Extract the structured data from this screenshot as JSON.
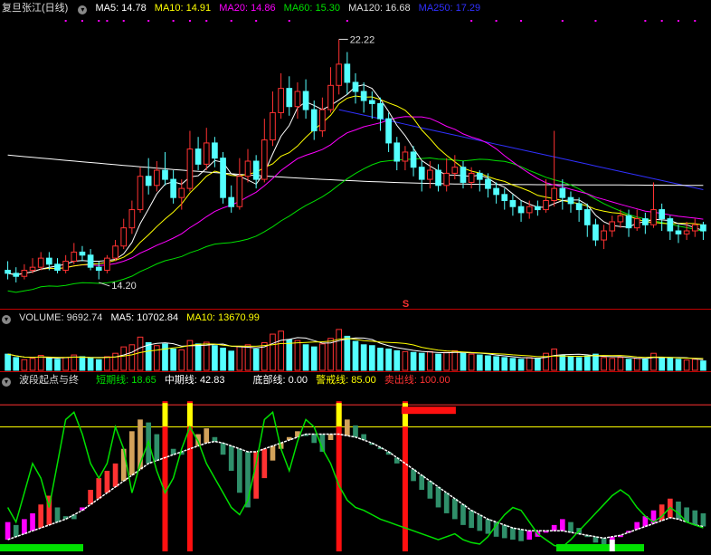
{
  "colors": {
    "bg": "#000000",
    "up": "#ff3232",
    "down": "#54ffff",
    "ma5": "#ffffff",
    "ma10": "#ffff00",
    "ma20": "#ff00ff",
    "ma60": "#00e000",
    "ma120": "#ffffff",
    "ma250": "#3030ff",
    "divider": "#c00000"
  },
  "price_panel": {
    "title": "复旦张江(日线)",
    "toggle_icon": "chevron-down-icon",
    "ma5_label": "MA5: 14.78",
    "ma10_label": "MA10: 14.91",
    "ma20_label": "MA20: 14.86",
    "ma60_label": "MA60: 15.30",
    "ma120_label": "MA120: 16.68",
    "ma250_label": "MA250: 17.29",
    "high_label": "22.22",
    "low_label": "14.20",
    "signal_mark": "S"
  },
  "volume_panel": {
    "volume_label": "VOLUME: 9692.74",
    "ma5_label": "MA5: 10702.84",
    "ma10_label": "MA10: 13670.99"
  },
  "indicator_panel": {
    "title": "波段起点与终",
    "short_label": "短期线: 18.65",
    "mid_label": "中期线: 42.83",
    "bottom_label": "底部线: 0.00",
    "warn_label": "警戒线: 85.00",
    "sell_label": "卖出线: 100.00"
  },
  "chart_data": {
    "type": "candlestick",
    "price_extremes": {
      "high": 22.22,
      "low": 14.2
    },
    "candles": [
      [
        14.6,
        14.5,
        14.9,
        14.3
      ],
      [
        14.5,
        14.4,
        14.7,
        14.2
      ],
      [
        14.4,
        14.6,
        14.8,
        14.3
      ],
      [
        14.6,
        14.7,
        15.0,
        14.5
      ],
      [
        14.7,
        15.0,
        15.2,
        14.6
      ],
      [
        15.0,
        14.8,
        15.2,
        14.6
      ],
      [
        14.8,
        14.6,
        15.0,
        14.5
      ],
      [
        14.6,
        14.9,
        15.1,
        14.5
      ],
      [
        14.9,
        15.2,
        15.5,
        14.8
      ],
      [
        15.2,
        15.1,
        15.4,
        14.9
      ],
      [
        15.1,
        14.7,
        15.3,
        14.6
      ],
      [
        14.7,
        14.6,
        14.9,
        14.3
      ],
      [
        14.6,
        15.0,
        15.1,
        14.5
      ],
      [
        15.0,
        15.4,
        15.6,
        14.9
      ],
      [
        15.4,
        16.0,
        16.3,
        15.3
      ],
      [
        16.0,
        16.6,
        16.9,
        15.8
      ],
      [
        16.6,
        17.7,
        18.0,
        16.5
      ],
      [
        17.7,
        17.4,
        18.3,
        17.1
      ],
      [
        17.4,
        17.9,
        18.2,
        17.2
      ],
      [
        17.9,
        17.6,
        18.5,
        17.4
      ],
      [
        17.6,
        17.0,
        17.9,
        16.8
      ],
      [
        17.0,
        17.3,
        17.6,
        16.6
      ],
      [
        17.3,
        18.6,
        19.2,
        17.2
      ],
      [
        18.6,
        18.1,
        19.0,
        17.9
      ],
      [
        18.1,
        18.8,
        19.3,
        17.9
      ],
      [
        18.8,
        18.3,
        19.0,
        18.0
      ],
      [
        18.3,
        17.0,
        18.5,
        16.8
      ],
      [
        17.0,
        16.7,
        17.4,
        16.5
      ],
      [
        16.7,
        17.7,
        18.3,
        16.6
      ],
      [
        17.7,
        18.2,
        18.6,
        17.5
      ],
      [
        18.2,
        17.6,
        18.4,
        17.3
      ],
      [
        17.6,
        18.9,
        19.6,
        17.5
      ],
      [
        18.9,
        19.8,
        20.5,
        18.7
      ],
      [
        19.8,
        20.6,
        21.1,
        19.6
      ],
      [
        20.6,
        20.0,
        21.0,
        19.7
      ],
      [
        20.0,
        20.5,
        20.8,
        19.6
      ],
      [
        20.5,
        19.9,
        20.9,
        19.6
      ],
      [
        19.9,
        19.2,
        20.2,
        18.9
      ],
      [
        19.2,
        19.9,
        20.3,
        19.0
      ],
      [
        19.9,
        20.7,
        21.3,
        19.8
      ],
      [
        20.7,
        21.4,
        22.22,
        20.4
      ],
      [
        21.4,
        20.8,
        21.8,
        20.4
      ],
      [
        20.8,
        20.5,
        21.1,
        20.1
      ],
      [
        20.5,
        20.2,
        20.8,
        19.8
      ],
      [
        20.2,
        20.1,
        20.5,
        19.6
      ],
      [
        20.1,
        19.6,
        20.3,
        19.2
      ],
      [
        19.6,
        18.8,
        19.8,
        18.5
      ],
      [
        18.8,
        18.2,
        19.0,
        17.9
      ],
      [
        18.2,
        18.5,
        18.7,
        17.9
      ],
      [
        18.5,
        18.0,
        18.7,
        17.7
      ],
      [
        18.0,
        17.6,
        18.2,
        17.2
      ],
      [
        17.6,
        17.9,
        18.2,
        17.3
      ],
      [
        17.9,
        17.4,
        18.1,
        17.2
      ],
      [
        17.4,
        17.8,
        18.3,
        17.2
      ],
      [
        17.8,
        18.0,
        18.4,
        17.6
      ],
      [
        18.0,
        17.5,
        18.2,
        17.3
      ],
      [
        17.5,
        17.8,
        18.0,
        17.3
      ],
      [
        17.8,
        17.6,
        17.9,
        17.2
      ],
      [
        17.6,
        17.3,
        17.8,
        17.0
      ],
      [
        17.3,
        17.1,
        17.5,
        16.8
      ],
      [
        17.1,
        16.9,
        17.3,
        16.6
      ],
      [
        16.9,
        16.7,
        17.1,
        16.4
      ],
      [
        16.7,
        16.5,
        16.9,
        16.2
      ],
      [
        16.5,
        16.7,
        16.9,
        16.3
      ],
      [
        16.7,
        16.6,
        16.9,
        16.4
      ],
      [
        16.6,
        16.9,
        17.6,
        16.5
      ],
      [
        16.9,
        17.3,
        19.2,
        16.7
      ],
      [
        17.3,
        17.0,
        17.6,
        16.6
      ],
      [
        17.0,
        16.8,
        17.2,
        16.5
      ],
      [
        16.8,
        16.6,
        17.0,
        16.2
      ],
      [
        16.6,
        16.1,
        16.8,
        15.7
      ],
      [
        16.1,
        15.6,
        16.3,
        15.4
      ],
      [
        15.6,
        15.9,
        16.1,
        15.3
      ],
      [
        15.9,
        16.2,
        16.4,
        15.7
      ],
      [
        16.2,
        16.4,
        16.6,
        16.0
      ],
      [
        16.4,
        16.0,
        16.6,
        15.7
      ],
      [
        16.0,
        16.3,
        16.6,
        15.9
      ],
      [
        16.3,
        16.1,
        16.5,
        15.8
      ],
      [
        16.1,
        16.6,
        17.5,
        16.0
      ],
      [
        16.6,
        16.3,
        16.8,
        15.9
      ],
      [
        16.3,
        15.9,
        16.4,
        15.6
      ],
      [
        15.9,
        15.8,
        16.1,
        15.5
      ],
      [
        15.8,
        15.9,
        16.2,
        15.6
      ],
      [
        15.9,
        16.1,
        16.3,
        15.7
      ],
      [
        16.1,
        15.9,
        16.2,
        15.6
      ]
    ],
    "volumes": [
      38,
      30,
      25,
      28,
      35,
      30,
      26,
      30,
      36,
      32,
      28,
      25,
      32,
      40,
      55,
      60,
      78,
      65,
      58,
      62,
      50,
      48,
      70,
      62,
      66,
      58,
      52,
      45,
      56,
      60,
      50,
      65,
      85,
      92,
      72,
      70,
      60,
      55,
      62,
      75,
      96,
      80,
      68,
      60,
      58,
      52,
      50,
      46,
      44,
      42,
      40,
      44,
      38,
      42,
      46,
      40,
      38,
      36,
      34,
      32,
      30,
      28,
      26,
      30,
      28,
      40,
      50,
      36,
      32,
      30,
      34,
      38,
      30,
      28,
      30,
      26,
      28,
      26,
      40,
      30,
      28,
      26,
      24,
      26,
      22
    ],
    "indicator": {
      "short_line": 18.65,
      "mid_line": 42.83,
      "bottom_line": 0.0,
      "warn_line": 85.0,
      "sell_line": 100.0,
      "short_series": [
        20,
        18,
        22,
        26,
        32,
        38,
        30,
        24,
        22,
        30,
        42,
        50,
        55,
        60,
        70,
        82,
        90,
        88,
        80,
        76,
        70,
        66,
        72,
        80,
        84,
        78,
        66,
        55,
        40,
        30,
        36,
        50,
        62,
        70,
        78,
        82,
        80,
        74,
        68,
        76,
        88,
        90,
        86,
        80,
        74,
        70,
        66,
        60,
        54,
        48,
        42,
        36,
        30,
        26,
        22,
        18,
        16,
        14,
        12,
        10,
        9,
        8,
        7,
        8,
        10,
        14,
        18,
        22,
        20,
        16,
        10,
        6,
        3,
        6,
        10,
        14,
        20,
        24,
        28,
        32,
        36,
        34,
        30,
        28,
        26
      ],
      "mid_series": [
        8,
        10,
        12,
        14,
        16,
        18,
        20,
        22,
        25,
        28,
        32,
        36,
        40,
        44,
        48,
        52,
        56,
        60,
        62,
        64,
        66,
        68,
        70,
        72,
        74,
        75,
        74,
        72,
        70,
        68,
        68,
        70,
        72,
        74,
        76,
        78,
        80,
        80,
        80,
        80,
        80,
        79,
        78,
        76,
        74,
        71,
        68,
        64,
        60,
        56,
        52,
        48,
        44,
        40,
        36,
        32,
        28,
        25,
        22,
        20,
        18,
        16,
        15,
        14,
        14,
        14,
        14,
        14,
        13,
        12,
        11,
        10,
        9,
        10,
        11,
        13,
        15,
        17,
        19,
        21,
        23,
        22,
        20,
        18,
        17
      ],
      "green_line": [
        30,
        20,
        40,
        60,
        50,
        30,
        60,
        90,
        95,
        80,
        60,
        50,
        60,
        85,
        70,
        40,
        60,
        75,
        55,
        40,
        50,
        70,
        85,
        75,
        60,
        50,
        40,
        30,
        25,
        35,
        60,
        90,
        95,
        70,
        55,
        75,
        90,
        85,
        70,
        60,
        45,
        35,
        30,
        28,
        25,
        22,
        20,
        18,
        16,
        14,
        12,
        10,
        8,
        10,
        12,
        8,
        6,
        5,
        10,
        18,
        25,
        30,
        28,
        20,
        12,
        8,
        4,
        3,
        8,
        14,
        20,
        26,
        32,
        38,
        42,
        38,
        30,
        24,
        20,
        24,
        30,
        26,
        20,
        18,
        16
      ],
      "signal_bars": [
        {
          "index": 19,
          "level": 100
        },
        {
          "index": 22,
          "level": 100
        },
        {
          "index": 40,
          "level": 100
        },
        {
          "index": 48,
          "level": 100
        }
      ]
    }
  }
}
